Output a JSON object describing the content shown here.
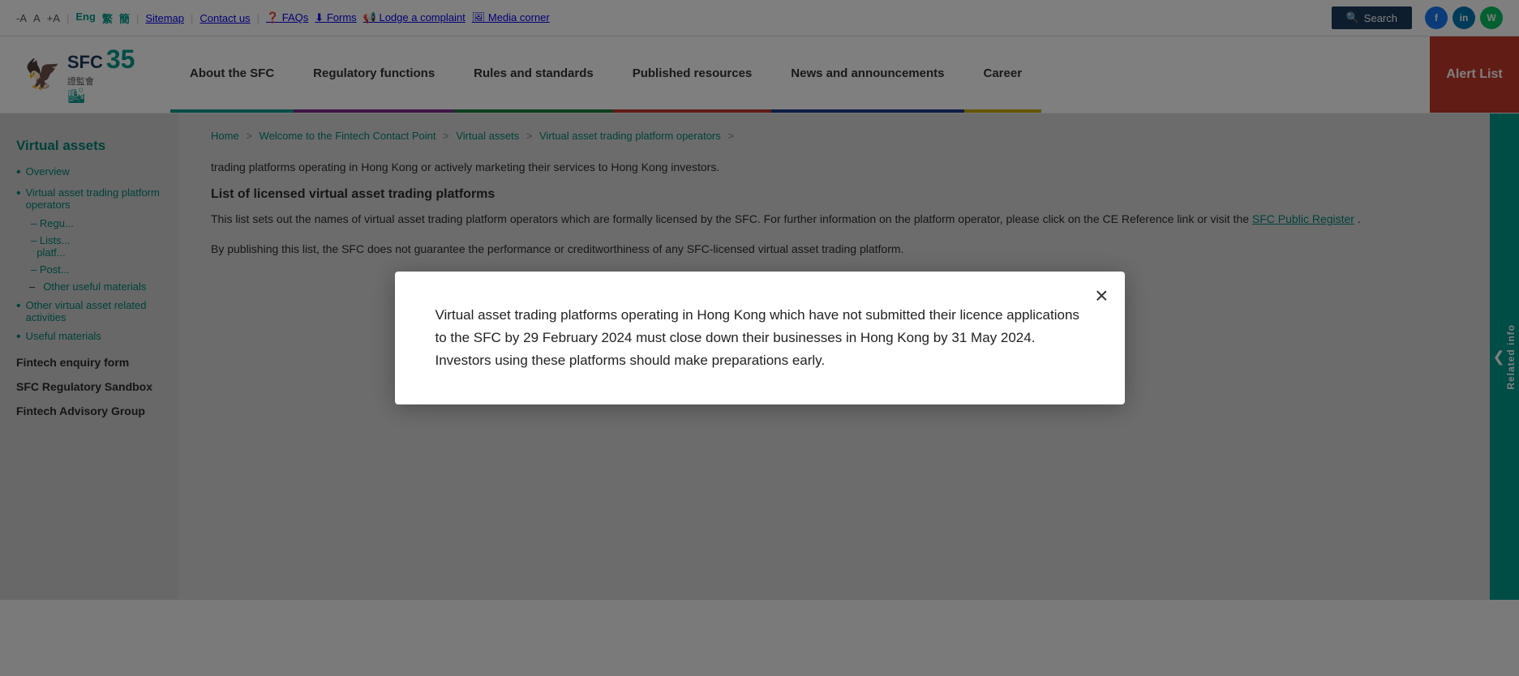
{
  "topbar": {
    "font_decrease": "-A",
    "font_normal": "A",
    "font_increase": "+A",
    "lang_eng": "Eng",
    "lang_trad": "繁",
    "lang_simp": "簡",
    "sitemap": "Sitemap",
    "contact_us": "Contact us",
    "faqs": "FAQs",
    "forms": "Forms",
    "lodge_complaint": "Lodge a complaint",
    "media_corner": "Media corner",
    "search_label": "Search"
  },
  "nav": {
    "about": "About the SFC",
    "regulatory": "Regulatory functions",
    "rules": "Rules and standards",
    "published": "Published resources",
    "news": "News and announcements",
    "career": "Career",
    "alert": "Alert List"
  },
  "logo": {
    "num": "35",
    "sfc": "SFC",
    "chinese": "證監會",
    "buildings": "🏙"
  },
  "breadcrumb": {
    "home": "Home",
    "welcome": "Welcome to the Fintech Contact Point",
    "virtual_assets": "Virtual assets",
    "operators": "Virtual asset trading platform operators"
  },
  "sidebar": {
    "title": "Virtual assets",
    "items": [
      {
        "label": "Overview",
        "bullet": true
      },
      {
        "label": "Virtual asset trading platform operators",
        "bullet": true
      },
      {
        "sub": [
          {
            "label": "Regulatory requirements"
          },
          {
            "label": "List of licensed virtual asset trading platforms"
          },
          {
            "label": "Postings"
          }
        ]
      },
      {
        "label": "Other useful materials",
        "indent": true
      },
      {
        "label": "Other virtual asset related activities",
        "bullet": true
      },
      {
        "label": "Useful materials",
        "bullet": true
      }
    ],
    "links": [
      {
        "label": "Fintech enquiry form"
      },
      {
        "label": "SFC Regulatory Sandbox"
      },
      {
        "label": "Fintech Advisory Group"
      }
    ]
  },
  "content": {
    "partial_text_1": "trading platforms operating in Hong Kong or actively marketing their services to Hong Kong investors.",
    "list_title": "List of licensed virtual asset trading platforms",
    "para1": "This list sets out the names of virtual asset trading platform operators which are formally licensed by the SFC. For further information on the platform operator, please click on the CE Reference link or visit the",
    "para1_link": "SFC Public Register",
    "para1_end": ".",
    "para2": "By publishing this list, the SFC does not guarantee the performance or creditworthiness of any SFC-licensed virtual asset trading platform."
  },
  "right_panel": {
    "related_info": "Related info"
  },
  "modal": {
    "text": "Virtual asset trading platforms operating in Hong Kong which have not submitted their licence applications to the SFC by 29 February 2024 must close down their businesses in Hong Kong by 31 May 2024. Investors using these platforms should make preparations early.",
    "close_label": "×"
  }
}
